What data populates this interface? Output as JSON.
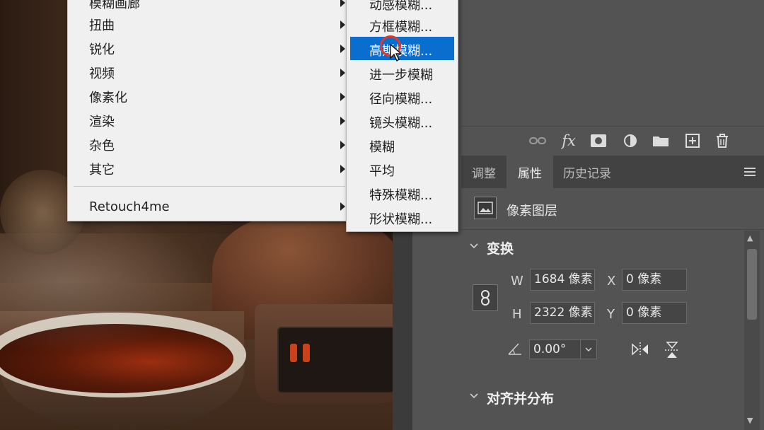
{
  "menu": {
    "items": [
      {
        "label": "模糊画廊",
        "submenu": true
      },
      {
        "label": "扭曲",
        "submenu": true
      },
      {
        "label": "锐化",
        "submenu": true
      },
      {
        "label": "视频",
        "submenu": true
      },
      {
        "label": "像素化",
        "submenu": true
      },
      {
        "label": "渲染",
        "submenu": true
      },
      {
        "label": "杂色",
        "submenu": true
      },
      {
        "label": "其它",
        "submenu": true
      }
    ],
    "plugin_item": {
      "label": "Retouch4me",
      "submenu": true
    }
  },
  "submenu": {
    "items": [
      {
        "label": "动感模糊..."
      },
      {
        "label": "方框模糊..."
      },
      {
        "label": "高斯模糊...",
        "highlighted": true
      },
      {
        "label": "进一步模糊"
      },
      {
        "label": "径向模糊..."
      },
      {
        "label": "镜头模糊..."
      },
      {
        "label": "模糊"
      },
      {
        "label": "平均"
      },
      {
        "label": "特殊模糊..."
      },
      {
        "label": "形状模糊..."
      }
    ],
    "highlight_color": "#0a6ecf"
  },
  "layers_toolbar": {
    "icons": [
      "link-layers-icon",
      "fx-icon",
      "add-mask-icon",
      "adjustment-layer-icon",
      "folder-icon",
      "new-layer-icon",
      "trash-icon"
    ],
    "fx_label": "fx"
  },
  "panel": {
    "tabs": [
      {
        "label": "调整"
      },
      {
        "label": "属性",
        "active": true
      },
      {
        "label": "历史记录"
      }
    ],
    "layer_type": "像素图层",
    "transform": {
      "title": "变换",
      "w_label": "W",
      "w_value": "1684 像素",
      "h_label": "H",
      "h_value": "2322 像素",
      "x_label": "X",
      "x_value": "0 像素",
      "y_label": "Y",
      "y_value": "0 像素",
      "angle_value": "0.00°"
    },
    "align": {
      "title": "对齐并分布"
    }
  }
}
